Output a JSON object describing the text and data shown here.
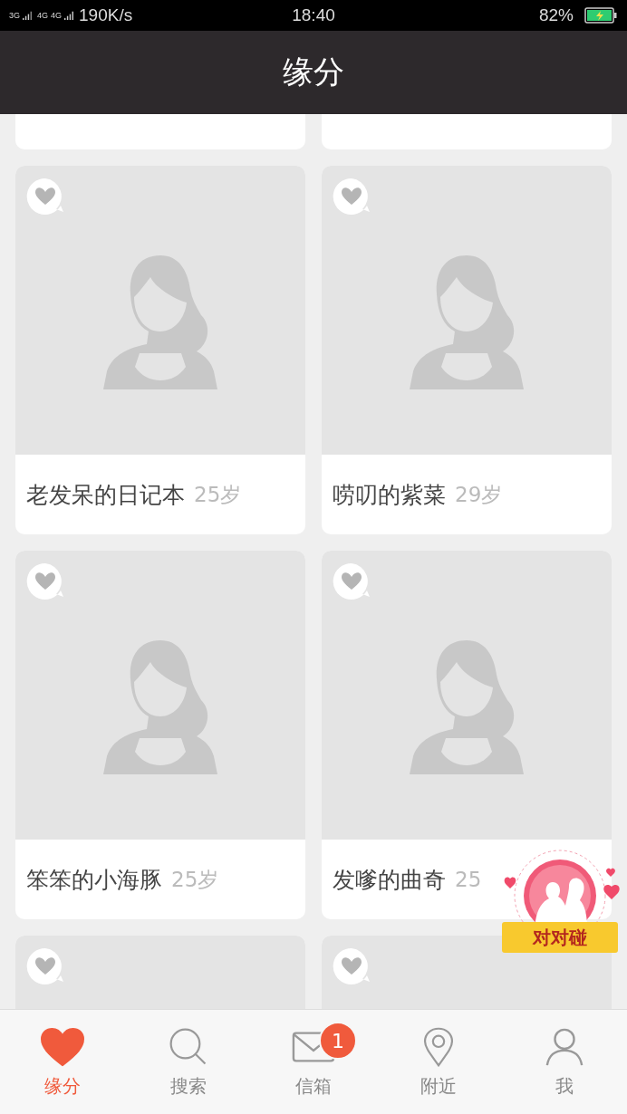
{
  "status_bar": {
    "network_1": "3G",
    "network_2": "4G",
    "network_3": "4G",
    "speed": "190K/s",
    "time": "18:40",
    "battery": "82%"
  },
  "header": {
    "title": "缘分"
  },
  "profiles": [
    {
      "kind": "top_edge"
    },
    {
      "kind": "top_edge"
    },
    {
      "kind": "profile",
      "name": "老发呆的日记本",
      "age": "25岁"
    },
    {
      "kind": "profile",
      "name": "唠叨的紫菜",
      "age": "29岁"
    },
    {
      "kind": "profile",
      "name": "笨笨的小海豚",
      "age": "25岁"
    },
    {
      "kind": "profile",
      "name": "发嗲的曲奇",
      "age": "25"
    },
    {
      "kind": "bottom_edge"
    },
    {
      "kind": "bottom_edge"
    }
  ],
  "floating_badge": {
    "label": "对对碰"
  },
  "tabs": [
    {
      "label": "缘分",
      "kind": "heart",
      "selected": true
    },
    {
      "label": "搜索",
      "kind": "search",
      "selected": false
    },
    {
      "label": "信箱",
      "kind": "mail",
      "selected": false,
      "badge": "1"
    },
    {
      "label": "附近",
      "kind": "pin",
      "selected": false
    },
    {
      "label": "我",
      "kind": "person",
      "selected": false
    }
  ]
}
